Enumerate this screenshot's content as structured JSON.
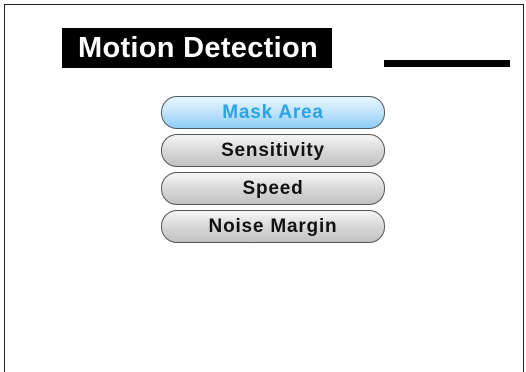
{
  "screen": {
    "title": "Motion Detection"
  },
  "menu": {
    "items": [
      {
        "label": "Mask Area",
        "selected": true
      },
      {
        "label": "Sensitivity",
        "selected": false
      },
      {
        "label": "Speed",
        "selected": false
      },
      {
        "label": "Noise Margin",
        "selected": false
      }
    ]
  },
  "colors": {
    "title_bg": "#000000",
    "title_text": "#ffffff",
    "selected_text": "#2aa3ea",
    "selected_fill": "#bfe4fb",
    "button_fill": "#d9d9d9"
  }
}
